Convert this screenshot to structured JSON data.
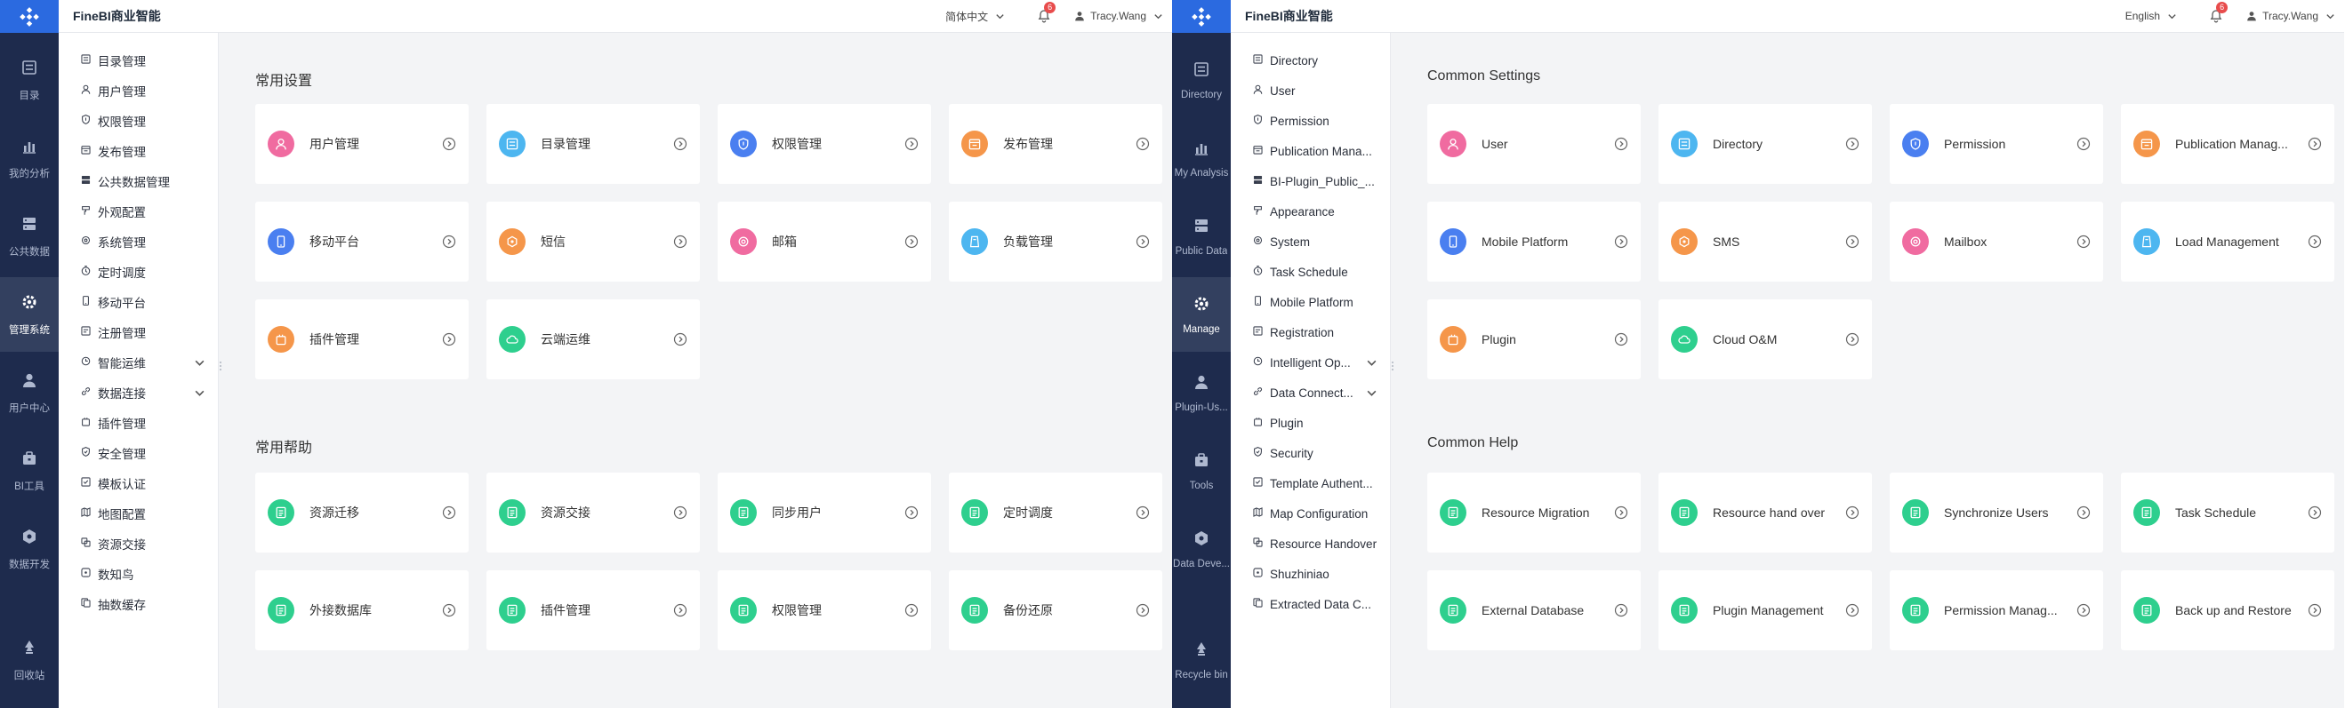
{
  "panels": {
    "zh": {
      "brand": "FineBI商业智能",
      "language": "简体中文",
      "notification_count": "6",
      "user_name": "Tracy.Wang",
      "rail": [
        {
          "label": "目录",
          "icon": "directory-icon"
        },
        {
          "label": "我的分析",
          "icon": "analysis-icon"
        },
        {
          "label": "公共数据",
          "icon": "public-data-icon"
        },
        {
          "label": "管理系统",
          "icon": "manage-icon",
          "active": true
        },
        {
          "label": "用户中心",
          "icon": "user-center-icon"
        },
        {
          "label": "BI工具",
          "icon": "tools-icon"
        },
        {
          "label": "数据开发",
          "icon": "data-dev-icon"
        },
        {
          "label": "回收站",
          "icon": "recycle-bin-icon"
        }
      ],
      "nav": [
        {
          "label": "目录管理",
          "icon": "directory-icon"
        },
        {
          "label": "用户管理",
          "icon": "user-icon"
        },
        {
          "label": "权限管理",
          "icon": "permission-icon"
        },
        {
          "label": "发布管理",
          "icon": "publication-icon"
        },
        {
          "label": "公共数据管理",
          "icon": "public-data-icon"
        },
        {
          "label": "外观配置",
          "icon": "appearance-icon"
        },
        {
          "label": "系统管理",
          "icon": "system-icon"
        },
        {
          "label": "定时调度",
          "icon": "schedule-icon"
        },
        {
          "label": "移动平台",
          "icon": "mobile-icon"
        },
        {
          "label": "注册管理",
          "icon": "registration-icon"
        },
        {
          "label": "智能运维",
          "icon": "intelligent-ops-icon",
          "expandable": true
        },
        {
          "label": "数据连接",
          "icon": "data-connection-icon",
          "expandable": true
        },
        {
          "label": "插件管理",
          "icon": "plugin-icon"
        },
        {
          "label": "安全管理",
          "icon": "security-icon"
        },
        {
          "label": "模板认证",
          "icon": "template-auth-icon"
        },
        {
          "label": "地图配置",
          "icon": "map-icon"
        },
        {
          "label": "资源交接",
          "icon": "handover-icon"
        },
        {
          "label": "数知鸟",
          "icon": "shuzhiniao-icon"
        },
        {
          "label": "抽数缓存",
          "icon": "extract-cache-icon"
        }
      ],
      "settings_title": "常用设置",
      "settings": [
        {
          "label": "用户管理",
          "icon": "user-icon",
          "color": "#f06ba0"
        },
        {
          "label": "目录管理",
          "icon": "directory-icon",
          "color": "#4db6f0"
        },
        {
          "label": "权限管理",
          "icon": "permission-icon",
          "color": "#4a7ff0"
        },
        {
          "label": "发布管理",
          "icon": "publication-icon",
          "color": "#f5964a"
        },
        {
          "label": "移动平台",
          "icon": "mobile-icon",
          "color": "#4a7ff0"
        },
        {
          "label": "短信",
          "icon": "sms-icon",
          "color": "#f5964a"
        },
        {
          "label": "邮箱",
          "icon": "mailbox-icon",
          "color": "#f06ba0"
        },
        {
          "label": "负载管理",
          "icon": "load-icon",
          "color": "#4db6f0"
        },
        {
          "label": "插件管理",
          "icon": "plugin-icon",
          "color": "#f5964a"
        },
        {
          "label": "云端运维",
          "icon": "cloud-icon",
          "color": "#2ecf8e"
        }
      ],
      "help_title": "常用帮助",
      "help": [
        {
          "label": "资源迁移",
          "icon": "doc-icon",
          "color": "#2ecf8e"
        },
        {
          "label": "资源交接",
          "icon": "doc-icon",
          "color": "#2ecf8e"
        },
        {
          "label": "同步用户",
          "icon": "doc-icon",
          "color": "#2ecf8e"
        },
        {
          "label": "定时调度",
          "icon": "doc-icon",
          "color": "#2ecf8e"
        },
        {
          "label": "外接数据库",
          "icon": "doc-icon",
          "color": "#2ecf8e"
        },
        {
          "label": "插件管理",
          "icon": "doc-icon",
          "color": "#2ecf8e"
        },
        {
          "label": "权限管理",
          "icon": "doc-icon",
          "color": "#2ecf8e"
        },
        {
          "label": "备份还原",
          "icon": "doc-icon",
          "color": "#2ecf8e"
        }
      ]
    },
    "en": {
      "brand": "FineBI商业智能",
      "language": "English",
      "notification_count": "6",
      "user_name": "Tracy.Wang",
      "rail": [
        {
          "label": "Directory",
          "icon": "directory-icon"
        },
        {
          "label": "My Analysis",
          "icon": "analysis-icon"
        },
        {
          "label": "Public Data",
          "icon": "public-data-icon"
        },
        {
          "label": "Manage",
          "icon": "manage-icon",
          "active": true
        },
        {
          "label": "Plugin-Us...",
          "icon": "user-center-icon"
        },
        {
          "label": "Tools",
          "icon": "tools-icon"
        },
        {
          "label": "Data Deve...",
          "icon": "data-dev-icon"
        },
        {
          "label": "Recycle bin",
          "icon": "recycle-bin-icon"
        }
      ],
      "nav": [
        {
          "label": "Directory",
          "icon": "directory-icon"
        },
        {
          "label": "User",
          "icon": "user-icon"
        },
        {
          "label": "Permission",
          "icon": "permission-icon"
        },
        {
          "label": "Publication Mana...",
          "icon": "publication-icon"
        },
        {
          "label": "BI-Plugin_Public_...",
          "icon": "public-data-icon"
        },
        {
          "label": "Appearance",
          "icon": "appearance-icon"
        },
        {
          "label": "System",
          "icon": "system-icon"
        },
        {
          "label": "Task Schedule",
          "icon": "schedule-icon"
        },
        {
          "label": "Mobile Platform",
          "icon": "mobile-icon"
        },
        {
          "label": "Registration",
          "icon": "registration-icon"
        },
        {
          "label": "Intelligent Op...",
          "icon": "intelligent-ops-icon",
          "expandable": true
        },
        {
          "label": "Data Connect...",
          "icon": "data-connection-icon",
          "expandable": true
        },
        {
          "label": "Plugin",
          "icon": "plugin-icon"
        },
        {
          "label": "Security",
          "icon": "security-icon"
        },
        {
          "label": "Template Authent...",
          "icon": "template-auth-icon"
        },
        {
          "label": "Map Configuration",
          "icon": "map-icon"
        },
        {
          "label": "Resource Handover",
          "icon": "handover-icon"
        },
        {
          "label": "Shuzhiniao",
          "icon": "shuzhiniao-icon"
        },
        {
          "label": "Extracted Data C...",
          "icon": "extract-cache-icon"
        }
      ],
      "settings_title": "Common Settings",
      "settings": [
        {
          "label": "User",
          "icon": "user-icon",
          "color": "#f06ba0"
        },
        {
          "label": "Directory",
          "icon": "directory-icon",
          "color": "#4db6f0"
        },
        {
          "label": "Permission",
          "icon": "permission-icon",
          "color": "#4a7ff0"
        },
        {
          "label": "Publication Manag...",
          "icon": "publication-icon",
          "color": "#f5964a"
        },
        {
          "label": "Mobile Platform",
          "icon": "mobile-icon",
          "color": "#4a7ff0"
        },
        {
          "label": "SMS",
          "icon": "sms-icon",
          "color": "#f5964a"
        },
        {
          "label": "Mailbox",
          "icon": "mailbox-icon",
          "color": "#f06ba0"
        },
        {
          "label": "Load Management",
          "icon": "load-icon",
          "color": "#4db6f0"
        },
        {
          "label": "Plugin",
          "icon": "plugin-icon",
          "color": "#f5964a"
        },
        {
          "label": "Cloud O&M",
          "icon": "cloud-icon",
          "color": "#2ecf8e"
        }
      ],
      "help_title": "Common Help",
      "help": [
        {
          "label": "Resource Migration",
          "icon": "doc-icon",
          "color": "#2ecf8e"
        },
        {
          "label": "Resource hand over",
          "icon": "doc-icon",
          "color": "#2ecf8e"
        },
        {
          "label": "Synchronize Users",
          "icon": "doc-icon",
          "color": "#2ecf8e"
        },
        {
          "label": "Task Schedule",
          "icon": "doc-icon",
          "color": "#2ecf8e"
        },
        {
          "label": "External Database",
          "icon": "doc-icon",
          "color": "#2ecf8e"
        },
        {
          "label": "Plugin Management",
          "icon": "doc-icon",
          "color": "#2ecf8e"
        },
        {
          "label": "Permission Manag...",
          "icon": "doc-icon",
          "color": "#2ecf8e"
        },
        {
          "label": "Back up and Restore",
          "icon": "doc-icon",
          "color": "#2ecf8e"
        }
      ]
    }
  }
}
